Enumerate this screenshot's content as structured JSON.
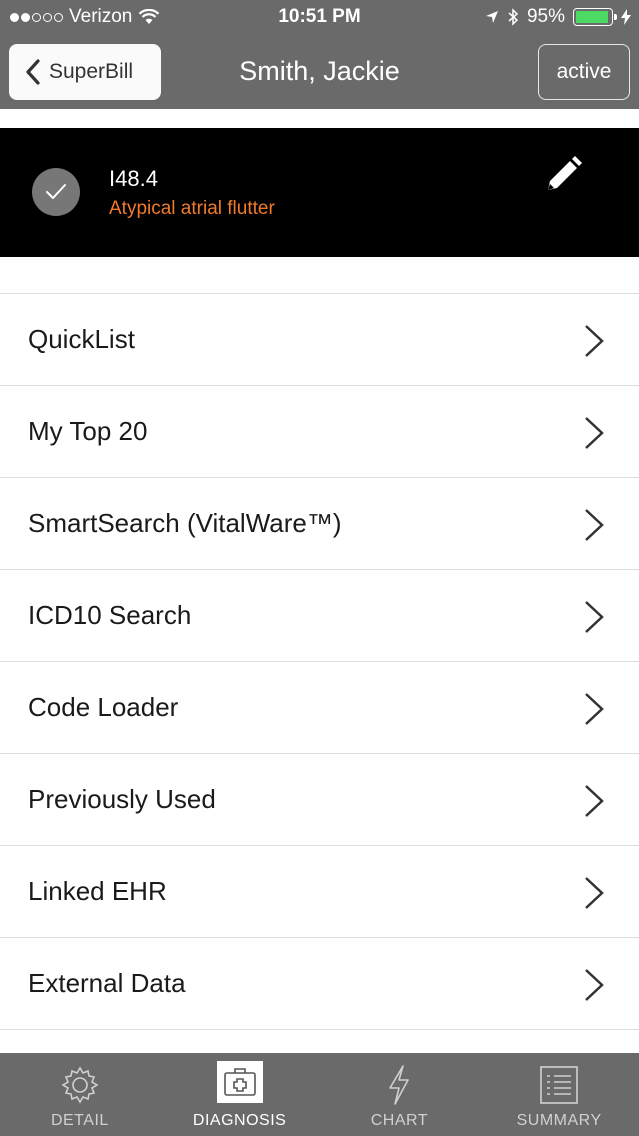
{
  "status_bar": {
    "carrier": "Verizon",
    "time": "10:51 PM",
    "battery_percent": "95%",
    "battery_level": 0.95,
    "signal_dots_filled": 2,
    "signal_dots_total": 5,
    "icons": [
      "wifi-icon",
      "location-icon",
      "bluetooth-icon",
      "battery-icon",
      "charging-icon"
    ]
  },
  "nav": {
    "back_label": "SuperBill",
    "title": "Smith, Jackie",
    "status_button": "active"
  },
  "selected_diagnosis": {
    "code": "I48.4",
    "description": "Atypical atrial flutter"
  },
  "menu": [
    {
      "label": "QuickList"
    },
    {
      "label": "My Top 20"
    },
    {
      "label": "SmartSearch (VitalWare™)"
    },
    {
      "label": "ICD10 Search"
    },
    {
      "label": "Code Loader"
    },
    {
      "label": "Previously Used"
    },
    {
      "label": "Linked EHR"
    },
    {
      "label": "External Data"
    }
  ],
  "tabs": [
    {
      "label": "DETAIL",
      "icon": "gear-icon"
    },
    {
      "label": "DIAGNOSIS",
      "icon": "medical-kit-icon",
      "active": true
    },
    {
      "label": "CHART",
      "icon": "lightning-icon"
    },
    {
      "label": "SUMMARY",
      "icon": "list-icon"
    }
  ],
  "colors": {
    "bar_gray": "#6a6a6a",
    "accent_orange": "#f07a2a",
    "battery_green": "#4cd964"
  }
}
